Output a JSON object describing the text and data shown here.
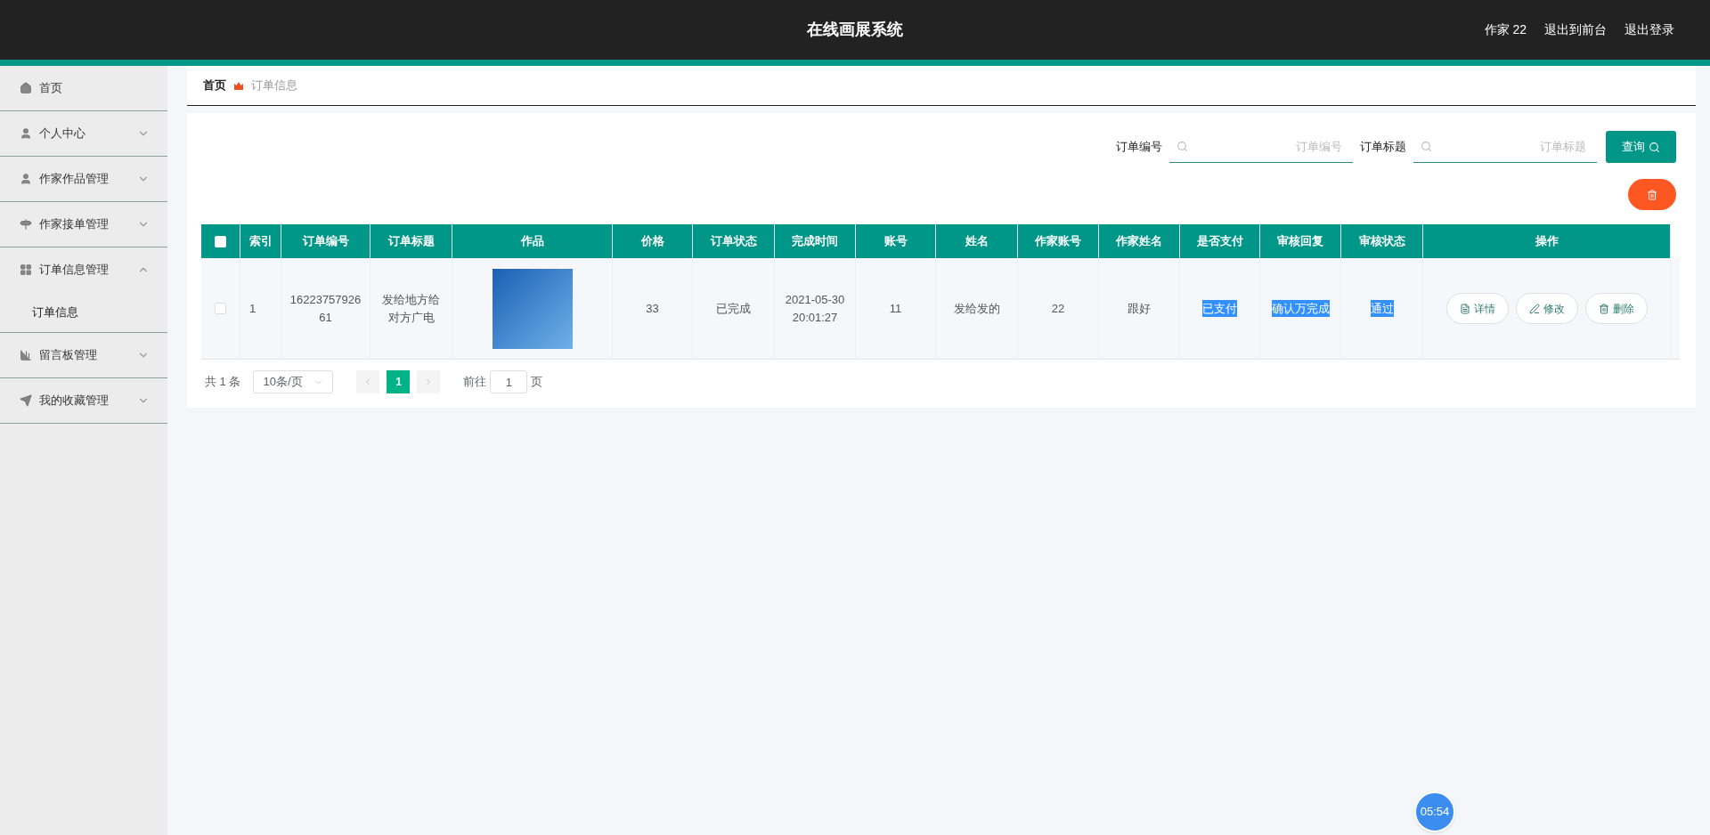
{
  "header": {
    "title": "在线画展系统",
    "links": [
      "作家 22",
      "退出到前台",
      "退出登录"
    ]
  },
  "sidebar": {
    "items": [
      {
        "label": "首页"
      },
      {
        "label": "个人中心",
        "expanded": false
      },
      {
        "label": "作家作品管理",
        "expanded": false
      },
      {
        "label": "作家接单管理",
        "expanded": false
      },
      {
        "label": "订单信息管理",
        "expanded": true,
        "children": [
          {
            "label": "订单信息"
          }
        ]
      },
      {
        "label": "留言板管理",
        "expanded": false
      },
      {
        "label": "我的收藏管理",
        "expanded": false
      }
    ]
  },
  "breadcrumb": {
    "home": "首页",
    "current": "订单信息"
  },
  "search": {
    "fields": [
      {
        "label": "订单编号",
        "placeholder": "订单编号"
      },
      {
        "label": "订单标题",
        "placeholder": "订单标题"
      }
    ],
    "button": "查询"
  },
  "table": {
    "columns": [
      "索引",
      "订单编号",
      "订单标题",
      "作品",
      "价格",
      "订单状态",
      "完成时间",
      "账号",
      "姓名",
      "作家账号",
      "作家姓名",
      "是否支付",
      "审核回复",
      "审核状态",
      "操作"
    ],
    "all_checked": false,
    "rows": [
      {
        "checked": false,
        "cells": [
          {
            "kind": "text",
            "text": "1",
            "highlighted": false
          },
          {
            "kind": "text",
            "text": "16223757926 61",
            "highlighted": false
          },
          {
            "kind": "text",
            "text": "发给地方给对方广电",
            "highlighted": false
          },
          {
            "kind": "image"
          },
          {
            "kind": "text",
            "text": "33",
            "highlighted": false
          },
          {
            "kind": "text",
            "text": "已完成",
            "highlighted": false
          },
          {
            "kind": "text",
            "text": "2021-05-30 20:01:27",
            "highlighted": false
          },
          {
            "kind": "text",
            "text": "11",
            "highlighted": false
          },
          {
            "kind": "text",
            "text": "发给发的",
            "highlighted": false
          },
          {
            "kind": "text",
            "text": "22",
            "highlighted": false
          },
          {
            "kind": "text",
            "text": "跟好",
            "highlighted": false
          },
          {
            "kind": "text",
            "text": "已支付",
            "highlighted": true
          },
          {
            "kind": "text",
            "text": "确认万完成",
            "highlighted": true
          },
          {
            "kind": "text",
            "text": "通过",
            "highlighted": true
          },
          {
            "kind": "actions",
            "actions": [
              {
                "label": "详情"
              },
              {
                "label": "修改"
              },
              {
                "label": "删除"
              }
            ]
          }
        ]
      }
    ]
  },
  "pagination": {
    "total": "共 1 条",
    "page_size": "10条/页",
    "pages": [
      {
        "label": "1",
        "selected": true
      }
    ],
    "goto_label": "前往",
    "goto_value": "1",
    "page_suffix": "页"
  },
  "timer": "05:54"
}
